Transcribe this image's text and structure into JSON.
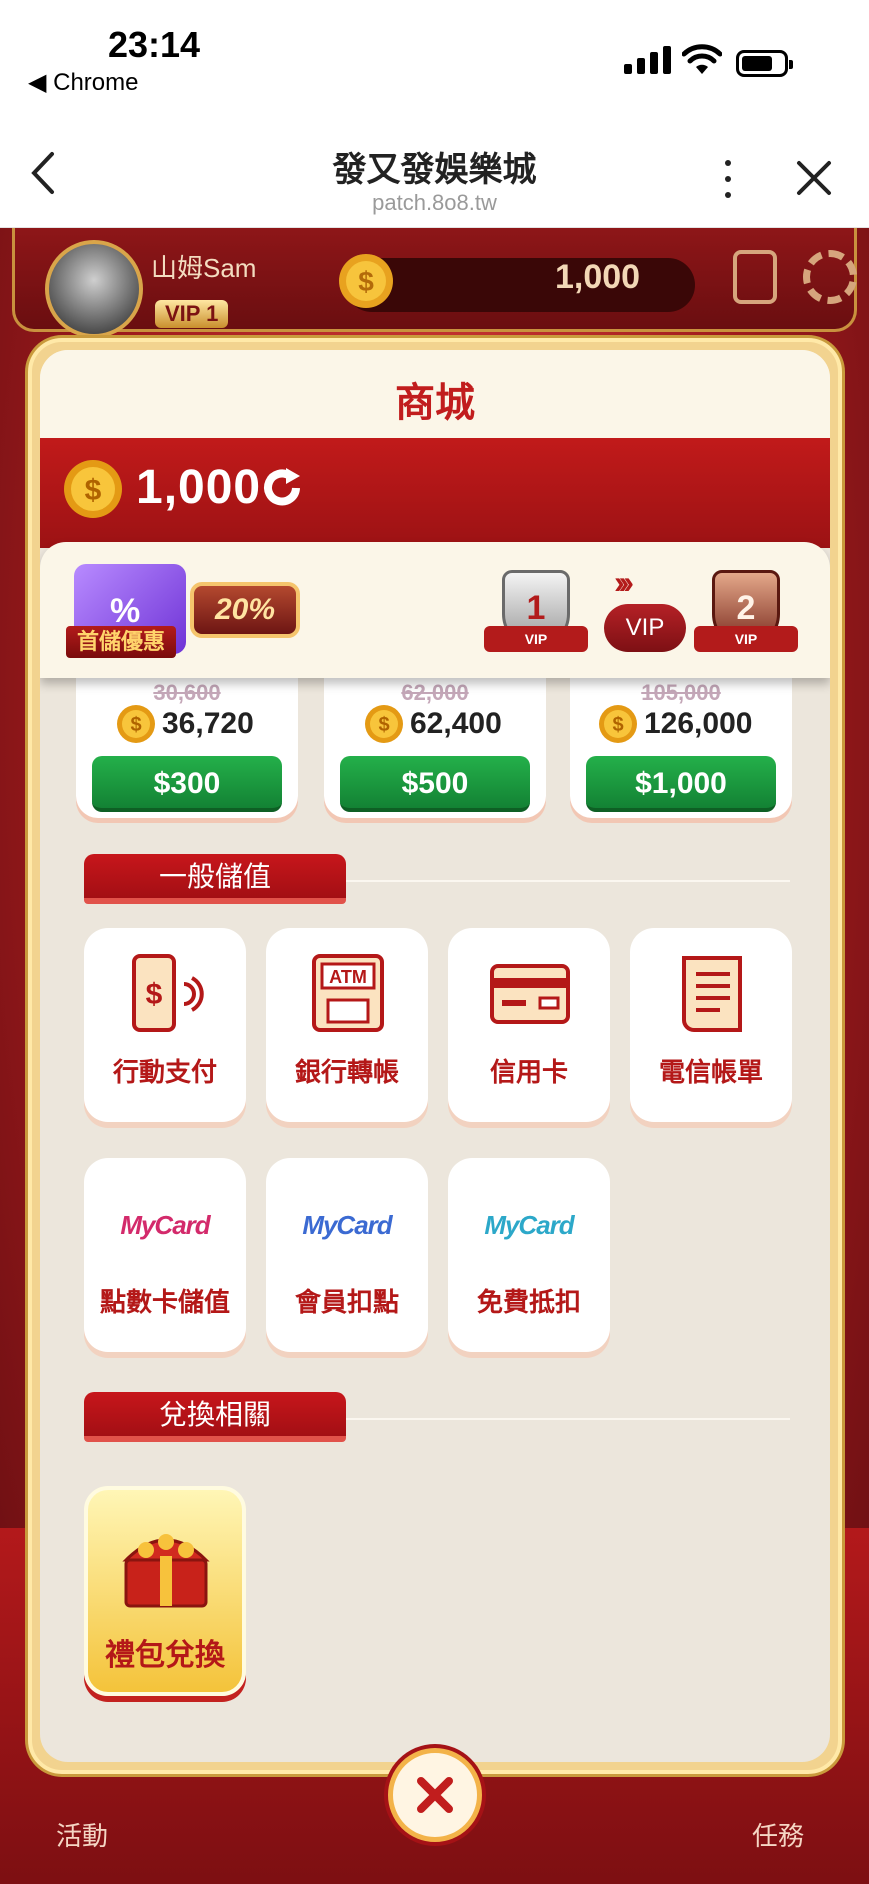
{
  "status_bar": {
    "time": "23:14",
    "back_app": "◀ Chrome"
  },
  "browser": {
    "title": "發又發娛樂城",
    "url": "patch.8o8.tw"
  },
  "game_header": {
    "username": "山姆Sam",
    "vip": "VIP 1",
    "coins": "1,000"
  },
  "dock": {
    "left_label": "活動",
    "right_label": "任務"
  },
  "shop": {
    "title": "商城",
    "balance": "1,000",
    "promo": {
      "ribbon": "首儲優惠",
      "discount": "20%",
      "vip_from": "1",
      "vip_to": "2",
      "vip_tag": "VIP",
      "vip_label": "VIP",
      "chevrons": "›››"
    },
    "packs": [
      {
        "old": "30,600",
        "coins": "36,720",
        "price": "$300"
      },
      {
        "old": "62,000",
        "coins": "62,400",
        "price": "$500"
      },
      {
        "old": "105,000",
        "coins": "126,000",
        "price": "$1,000"
      }
    ],
    "section_general": "一般儲值",
    "general": [
      {
        "label": "行動支付",
        "icon": "mobile-pay-icon"
      },
      {
        "label": "銀行轉帳",
        "icon": "atm-icon"
      },
      {
        "label": "信用卡",
        "icon": "credit-card-icon"
      },
      {
        "label": "電信帳單",
        "icon": "bill-icon"
      }
    ],
    "mycard_logo": "MyCard",
    "mycard": [
      {
        "label": "點數卡儲值"
      },
      {
        "label": "會員扣點"
      },
      {
        "label": "免費抵扣"
      }
    ],
    "section_exchange": "兌換相關",
    "gift_label": "禮包兌換"
  }
}
